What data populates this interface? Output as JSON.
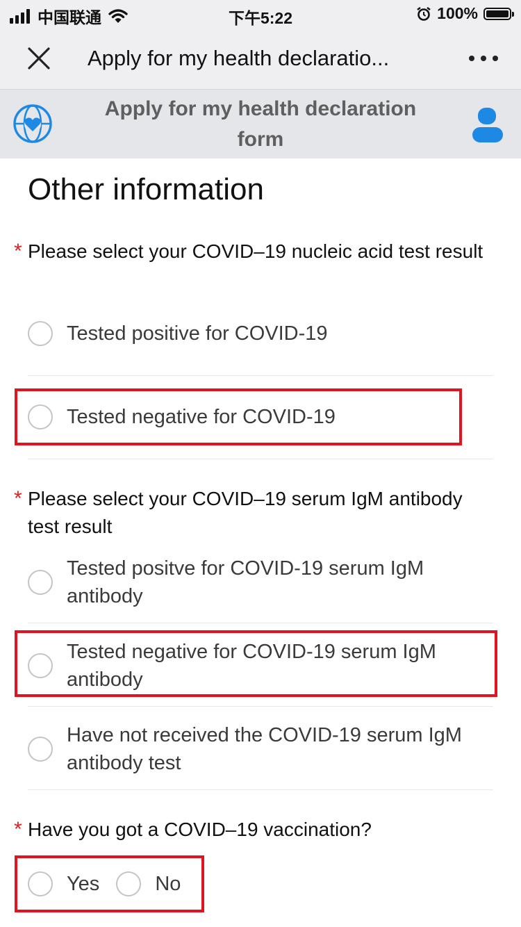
{
  "status_bar": {
    "carrier": "中国联通",
    "time": "下午5:22",
    "battery_percent": "100%"
  },
  "nav": {
    "title": "Apply for my health declaratio...",
    "close_icon": "close-icon",
    "more_icon": "more-dots-icon"
  },
  "app_header": {
    "title": "Apply for my health declaration form",
    "logo_icon": "globe-heart-icon",
    "user_icon": "user-icon",
    "accent_color": "#1e88e5"
  },
  "form": {
    "section_title": "Other information",
    "required_mark": "*",
    "q1": {
      "text": "Please select your COVID–19 nucleic acid test result",
      "options": [
        "Tested positive for COVID-19",
        "Tested negative for COVID-19"
      ]
    },
    "q2": {
      "text": "Please select your COVID–19 serum IgM antibody test result",
      "options": [
        "Tested positve for COVID-19 serum IgM antibody",
        "Tested negative for COVID-19 serum IgM antibody",
        "Have not received the COVID-19 serum IgM antibody test"
      ]
    },
    "q3": {
      "text": "Have you got a COVID–19 vaccination?",
      "options": [
        "Yes",
        "No"
      ]
    },
    "highlight_color": "#e0141e"
  }
}
